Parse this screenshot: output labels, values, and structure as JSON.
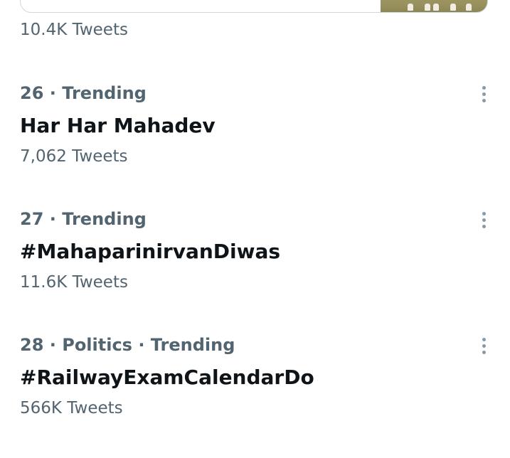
{
  "previous_trend": {
    "tweet_count": "10.4K Tweets"
  },
  "trends": [
    {
      "context": "26 · Trending",
      "name": "Har Har Mahadev",
      "tweet_count": "7,062 Tweets",
      "more_icon": "more-vertical-icon"
    },
    {
      "context": "27 · Trending",
      "name": "#MahaparinirvanDiwas",
      "tweet_count": "11.6K Tweets",
      "more_icon": "more-vertical-icon"
    },
    {
      "context": "28 · Politics · Trending",
      "name": "#RailwayExamCalendarDo",
      "tweet_count": "566K Tweets",
      "more_icon": "more-vertical-icon"
    }
  ],
  "colors": {
    "primary_text": "#0f1419",
    "secondary_text": "#536471",
    "icon": "#8899a6",
    "border": "#cfd9de"
  }
}
